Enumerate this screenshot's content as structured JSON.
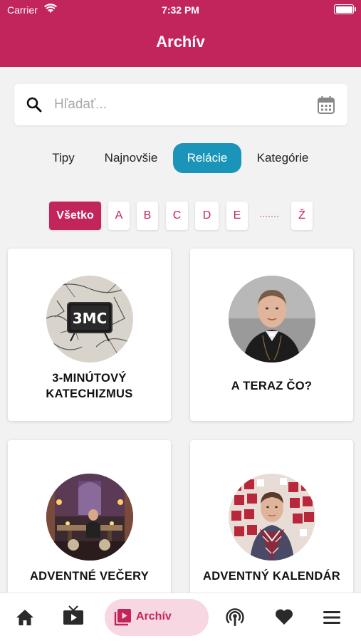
{
  "status_bar": {
    "carrier": "Carrier",
    "time": "7:32 PM"
  },
  "header": {
    "title": "Archív"
  },
  "search": {
    "placeholder": "Hľadať..."
  },
  "tabs": [
    {
      "label": "Tipy",
      "active": false
    },
    {
      "label": "Najnovšie",
      "active": false
    },
    {
      "label": "Relácie",
      "active": true
    },
    {
      "label": "Kategórie",
      "active": false
    }
  ],
  "letters": [
    {
      "label": "Všetko",
      "active": true
    },
    {
      "label": "A"
    },
    {
      "label": "B"
    },
    {
      "label": "C"
    },
    {
      "label": "D"
    },
    {
      "label": "E"
    },
    {
      "label": "·······"
    },
    {
      "label": "Ž"
    }
  ],
  "cards": [
    {
      "title_line1": "3-MINÚTOVÝ",
      "title_line2": "KATECHIZMUS",
      "thumb_text": "3MC"
    },
    {
      "title_line1": "A TERAZ ČO?",
      "title_line2": ""
    },
    {
      "title_line1": "ADVENTNÉ VEČERY",
      "title_line2": ""
    },
    {
      "title_line1": "ADVENTNÝ KALENDÁR",
      "title_line2": ""
    }
  ],
  "bottom_nav": {
    "active_label": "Archív",
    "items": [
      "home-icon",
      "tv-icon",
      "archive-icon",
      "podcast-icon",
      "heart-icon",
      "menu-icon"
    ]
  },
  "colors": {
    "brand": "#c2255c",
    "accent": "#1a94b8",
    "active_nav_bg": "#f7d7e2"
  }
}
